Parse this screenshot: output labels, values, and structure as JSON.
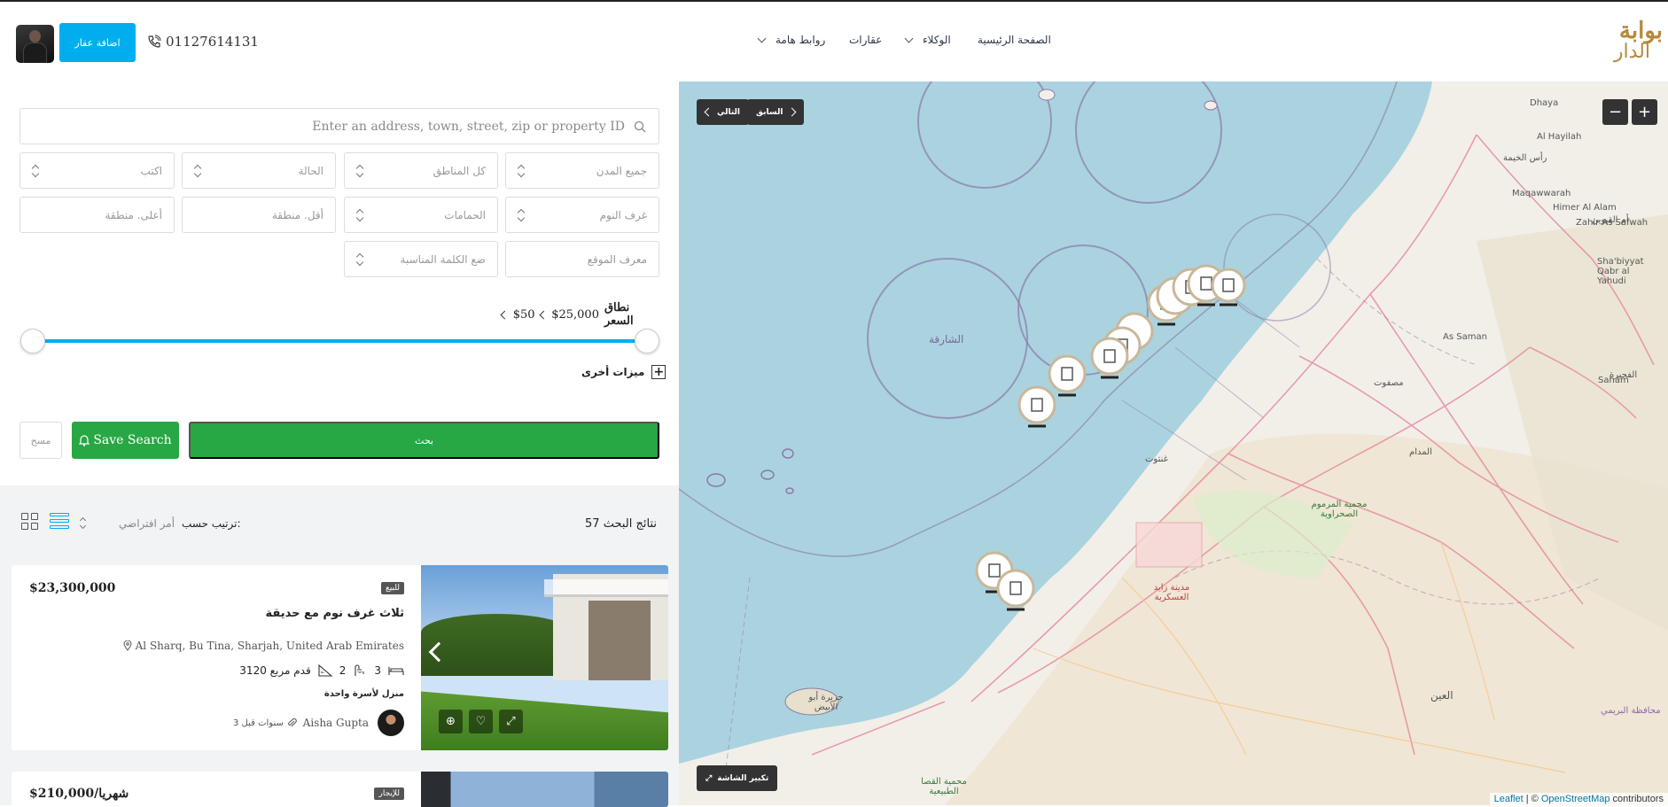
{
  "header": {
    "add_property": "اضافة عقار",
    "phone": "01127614131",
    "nav": {
      "home": "الصفحة الرئيسية",
      "agents": "الوكلاء",
      "properties": "عقارات",
      "links": "روابط هامة"
    },
    "logo_line1": "بوابة",
    "logo_line2": "الدار"
  },
  "search": {
    "placeholder": "Enter an address, town, street, zip or property ID",
    "cities": "جميع المدن",
    "areas": "كل المناطق",
    "status": "الحالة",
    "type": "اكتب",
    "bedrooms": "غرف النوم",
    "bathrooms": "الحمامات",
    "min_area": "أقل. منطقة",
    "max_area": "أعلى. منطقة",
    "property_id": "معرف الموقع",
    "keyword": "ضع الكلمة المناسبة",
    "price_label": "نطاق السعر",
    "price_max": "$25,000",
    "price_min": "$50",
    "more_features": "ميزات أخرى",
    "search_button": "بحث",
    "save_search": "Save Search",
    "reset": "مسح"
  },
  "results": {
    "count": "57 نتائج البحث",
    "sort_label": "ترتيب حسب:",
    "sort_value": "أمر افتراضي"
  },
  "listings": [
    {
      "price": "$23,300,000",
      "tag": "للبيع",
      "title": "ثلاث غرف نوم مع حديقة",
      "address": "Al Sharq, Bu Tina, Sharjah, United Arab Emirates",
      "beds": "3",
      "baths": "2",
      "area": "3120 قدم مربع",
      "type": "منزل لأسرة واحدة",
      "agent": "Aisha Gupta",
      "posted": "3 سنوات قبل"
    },
    {
      "price": "$210,000/شهريا",
      "tag": "للإيجار"
    }
  ],
  "map": {
    "prev": "السابق",
    "next": "التالي",
    "zoom_in": "+",
    "zoom_out": "−",
    "fullscreen": "تكبير الشاشة",
    "attribution_leaflet": "Leaflet",
    "attribution_sep": " | © ",
    "attribution_osm": "OpenStreetMap",
    "attribution_tail": " contributors",
    "labels": {
      "sharjah_sea": "الشارقة",
      "dhaya": "Dhaya",
      "hayilah": "Al Hayilah",
      "ras_khaimah": "رأس الخيمة",
      "maqawwarah": "Maqawwarah",
      "himer": "Himer Al Alam",
      "zahir": "Zahir As Safwah",
      "shabiyyat": "Sha'biyyat Qabr al Yahudi",
      "as_saman": "As Saman",
      "umm_qaiwain": "أم القيوين",
      "fujairah": "الفجيرة",
      "madam": "المدام",
      "ghantoot": "غنتوت",
      "marmoom": "محمية المرموم الصحراوية",
      "zayed_city": "مدينة زايد العسكرية",
      "alain": "العين",
      "abyad": "جزيرة أبو الأبيض",
      "alsila": "محمية القصا الطبيعية",
      "buraimi": "محافظة البريمي",
      "sahim": "Saham",
      "masfout": "مصفوت"
    }
  }
}
